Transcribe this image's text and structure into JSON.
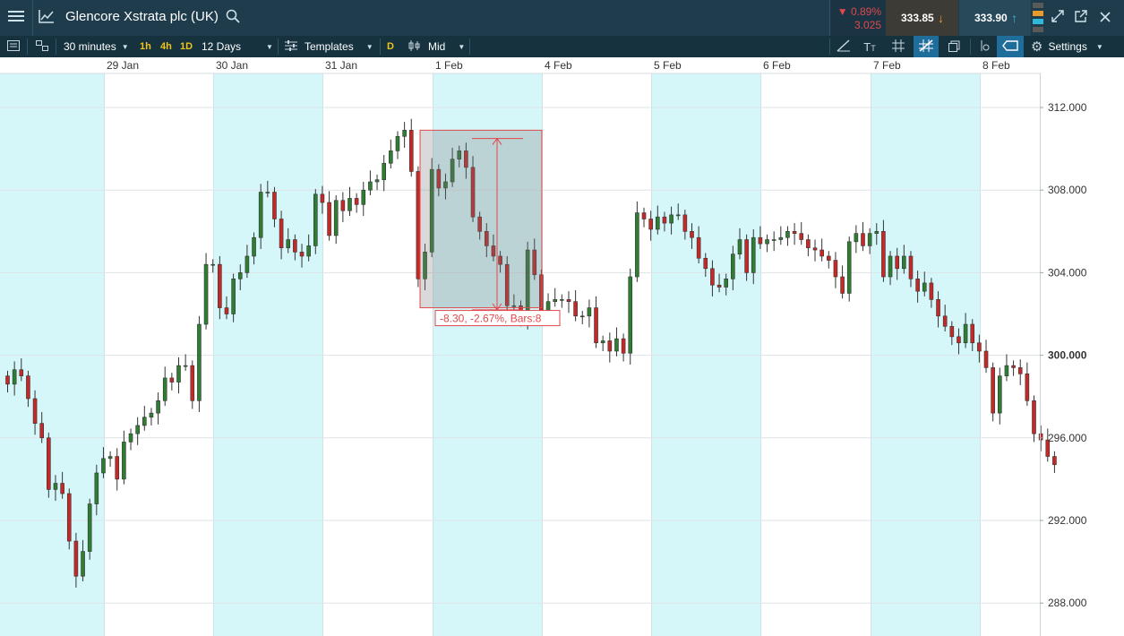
{
  "header": {
    "title": "Glencore Xstrata plc (UK)",
    "change_pct": "▼ 0.89%",
    "change_abs": "3.025",
    "sell_price": "333.85",
    "buy_price": "333.90",
    "icons": [
      "menu-icon",
      "line-chart-icon",
      "search-icon",
      "expand-icon",
      "popout-icon",
      "close-icon"
    ]
  },
  "toolbar": {
    "interval": "30 minutes",
    "quick_1h": "1h",
    "quick_4h": "4h",
    "quick_1d": "1D",
    "range": "12 Days",
    "templates": "Templates",
    "d_badge": "D",
    "price_type": "Mid",
    "settings": "Settings"
  },
  "colors": {
    "up": "#2f7d32",
    "down": "#c62828",
    "weekend_band": "#d6f7fa",
    "selection": "#e0474c"
  },
  "chart_data": {
    "type": "candlestick",
    "dates": [
      "29 Jan",
      "30 Jan",
      "31 Jan",
      "1 Feb",
      "4 Feb",
      "5 Feb",
      "6 Feb",
      "7 Feb",
      "8 Feb"
    ],
    "y_ticks": [
      "312.000",
      "308.000",
      "304.000",
      "300.000",
      "296.000",
      "292.000",
      "288.000"
    ],
    "highlight_tick": "300.000",
    "ylim": [
      287.6,
      313.6
    ],
    "measure_label": "-8.30, -2.67%, Bars:8",
    "close_series": [
      298.6,
      299.3,
      299.0,
      297.9,
      296.7,
      296.0,
      293.5,
      293.8,
      293.3,
      291.0,
      289.3,
      290.5,
      292.8,
      294.3,
      295.0,
      295.1,
      294.0,
      295.8,
      296.2,
      296.6,
      297.0,
      297.2,
      297.8,
      298.9,
      298.7,
      299.5,
      299.5,
      297.8,
      301.5,
      304.4,
      304.4,
      302.3,
      302.0,
      303.7,
      304.0,
      304.8,
      305.7,
      307.9,
      307.9,
      306.6,
      305.2,
      305.6,
      305.0,
      304.8,
      305.3,
      307.8,
      307.4,
      305.8,
      307.5,
      307.0,
      307.6,
      307.3,
      308.0,
      308.4,
      308.5,
      309.3,
      309.9,
      310.6,
      310.9,
      308.9,
      303.7,
      305.0,
      309.0,
      308.1,
      308.4,
      309.5,
      309.9,
      309.1,
      306.7,
      306.0,
      305.3,
      304.8,
      304.4,
      302.4,
      302.4,
      301.8,
      305.1,
      303.9,
      302.1,
      302.6,
      302.7,
      302.7,
      302.6,
      301.9,
      301.9,
      302.3,
      300.6,
      300.7,
      300.2,
      300.8,
      300.1,
      303.8,
      306.9,
      306.6,
      306.1,
      306.7,
      306.4,
      306.8,
      306.8,
      306.0,
      305.7,
      304.7,
      304.2,
      303.4,
      303.3,
      303.7,
      304.9,
      305.6,
      304.0,
      305.7,
      305.4,
      305.6,
      305.6,
      305.7,
      306.0,
      305.9,
      305.6,
      305.2,
      305.1,
      304.8,
      304.6,
      303.8,
      303.0,
      305.5,
      305.9,
      305.3,
      305.9,
      306.0,
      303.8,
      304.8,
      304.2,
      304.8,
      303.7,
      303.1,
      303.5,
      302.7,
      301.9,
      301.4,
      300.9,
      300.6,
      301.5,
      300.6,
      300.2,
      299.4,
      297.2,
      299.0,
      299.5,
      299.4,
      299.1,
      297.8,
      296.2,
      295.9,
      295.1,
      294.7
    ]
  }
}
